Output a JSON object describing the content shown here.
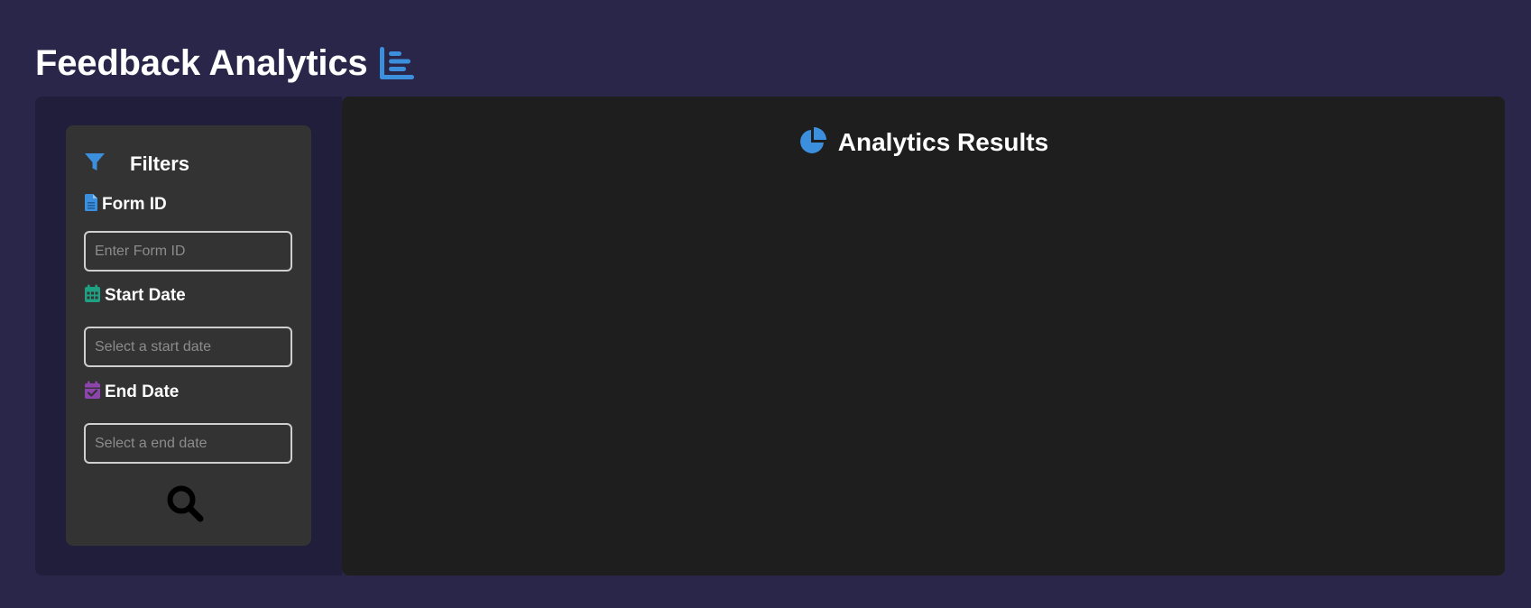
{
  "header": {
    "title": "Feedback Analytics",
    "icon": "bar-chart-icon"
  },
  "filters": {
    "title": "Filters",
    "icon": "filter-icon",
    "form_id": {
      "label": "Form ID",
      "icon": "file-icon",
      "value": "",
      "placeholder": "Enter Form ID"
    },
    "start_date": {
      "label": "Start Date",
      "icon": "calendar-icon",
      "value": "",
      "placeholder": "Select a start date"
    },
    "end_date": {
      "label": "End Date",
      "icon": "calendar-check-icon",
      "value": "",
      "placeholder": "Select a end date"
    },
    "search": {
      "icon": "search-icon"
    }
  },
  "results": {
    "title": "Analytics Results",
    "icon": "pie-chart-icon"
  },
  "colors": {
    "page_background": "#29264a",
    "sidebar_background": "#201e3b",
    "card_background": "#333333",
    "results_background": "#1e1e1e",
    "accent_blue": "#3b8fdc",
    "accent_green": "#20a082",
    "accent_purple": "#8e44ad",
    "text": "#ffffff"
  }
}
